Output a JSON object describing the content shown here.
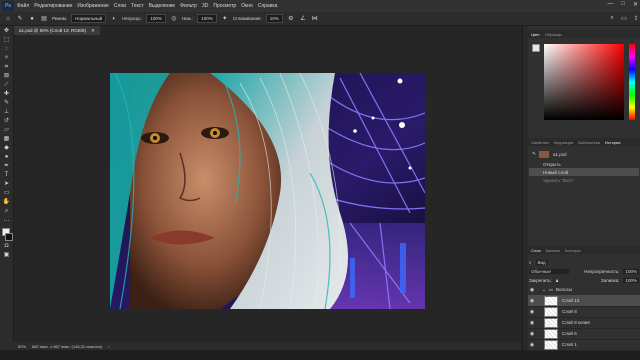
{
  "menu": {
    "logo": "Ps",
    "items": [
      "Файл",
      "Редактирование",
      "Изображение",
      "Слои",
      "Текст",
      "Выделение",
      "Фильтр",
      "3D",
      "Просмотр",
      "Окно",
      "Справка"
    ]
  },
  "window_controls": {
    "minimize": "—",
    "maximize": "□",
    "close": "✕"
  },
  "options": {
    "mode_label": "Режим:",
    "mode_value": "Нормальный",
    "opacity_label": "Непрозр.:",
    "opacity_value": "100%",
    "flow_label": "Наж.:",
    "flow_value": "100%",
    "smoothing_label": "Сглаживание:",
    "smoothing_value": "10%"
  },
  "document": {
    "tab_title": "a1.psd @ 50% (Слой 13, RGB/8)",
    "close": "✕"
  },
  "status": {
    "zoom": "50%",
    "info": "880 пикс. х 667 пикс. (146,31 пикс/cm)"
  },
  "color_panel": {
    "tab_active": "Цвет",
    "tab_2": "Образцы"
  },
  "history_panel": {
    "tabs": [
      "Свойства",
      "Коррекция",
      "Библиотеки",
      "История"
    ],
    "active_tab": "История",
    "snapshot": "a1.psd",
    "items": [
      "Открыть",
      "Новый слой",
      "Удалить \"Взгл\""
    ]
  },
  "layers_panel": {
    "tabs": [
      "Слои",
      "Каналы",
      "Контуры"
    ],
    "kind_label": "Вид",
    "blend_mode": "Обычные",
    "opacity_label": "Непрозрачность:",
    "opacity_value": "100%",
    "lock_label": "Закрепить:",
    "fill_label": "Заливка:",
    "fill_value": "100%",
    "group_name": "Волосы",
    "layers": [
      "Слой 13",
      "Слой 8",
      "Слой 9 копия",
      "Слой 6",
      "Слой 1"
    ]
  }
}
